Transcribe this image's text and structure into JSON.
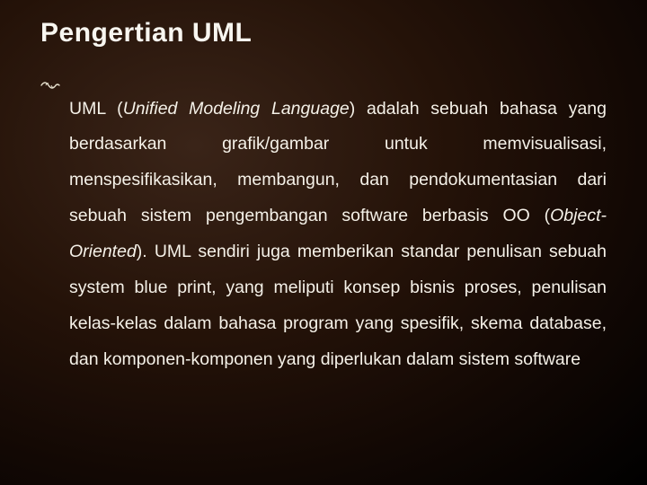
{
  "slide": {
    "title": "Pengertian UML",
    "bullet_icon": "vine-bullet",
    "body": {
      "seg1": "UML (",
      "seg2_italic": "Unified Modeling Language",
      "seg3": ") adalah sebuah bahasa yang berdasarkan grafik/gambar untuk memvisualisasi, menspesifikasikan, membangun, dan pendokumentasian dari sebuah sistem pengembangan software berbasis OO (",
      "seg4_italic": "Object-Oriented",
      "seg5": "). UML sendiri juga memberikan standar penulisan sebuah system blue print, yang meliputi konsep bisnis proses, penulisan kelas-kelas dalam bahasa program yang spesifik, skema database, dan komponen-komponen yang diperlukan dalam sistem software"
    }
  }
}
